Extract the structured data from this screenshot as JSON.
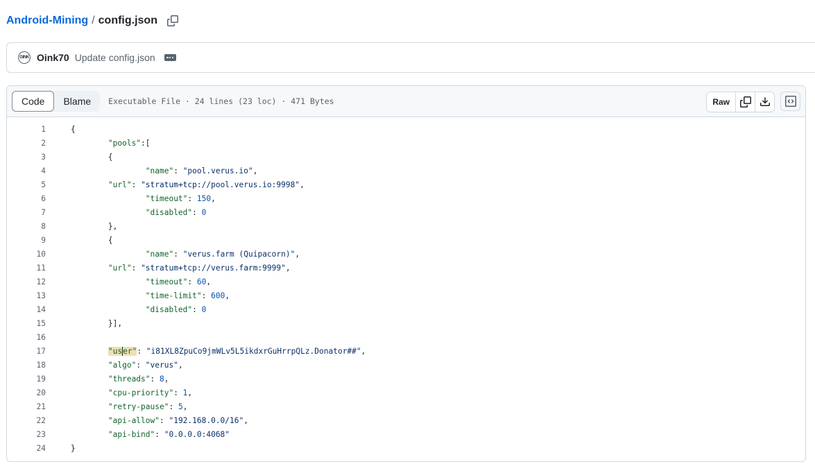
{
  "breadcrumb": {
    "repo": "Android-Mining",
    "separator": "/",
    "file": "config.json"
  },
  "commit": {
    "avatar_text": "OINK",
    "author": "Oink70",
    "message": "Update config.json"
  },
  "file_header": {
    "tabs": [
      {
        "label": "Code",
        "active": true
      },
      {
        "label": "Blame",
        "active": false
      }
    ],
    "meta": "Executable File · 24 lines (23 loc) · 471 Bytes",
    "raw_label": "Raw"
  },
  "code_lines": [
    {
      "num": "1",
      "text": "{"
    },
    {
      "num": "2",
      "text": "        \"pools\":["
    },
    {
      "num": "3",
      "text": "        {"
    },
    {
      "num": "4",
      "text": "                \"name\": \"pool.verus.io\","
    },
    {
      "num": "5",
      "text": "        \"url\": \"stratum+tcp://pool.verus.io:9998\","
    },
    {
      "num": "6",
      "text": "                \"timeout\": 150,"
    },
    {
      "num": "7",
      "text": "                \"disabled\": 0"
    },
    {
      "num": "8",
      "text": "        },"
    },
    {
      "num": "9",
      "text": "        {"
    },
    {
      "num": "10",
      "text": "                \"name\": \"verus.farm (Quipacorn)\","
    },
    {
      "num": "11",
      "text": "        \"url\": \"stratum+tcp://verus.farm:9999\","
    },
    {
      "num": "12",
      "text": "                \"timeout\": 60,"
    },
    {
      "num": "13",
      "text": "                \"time-limit\": 600,"
    },
    {
      "num": "14",
      "text": "                \"disabled\": 0"
    },
    {
      "num": "15",
      "text": "        }],"
    },
    {
      "num": "16",
      "text": ""
    },
    {
      "num": "17",
      "text": "        \"user\": \"i81XL8ZpuCo9jmWLv5L5ikdxrGuHrrpQLz.Donator##\","
    },
    {
      "num": "18",
      "text": "        \"algo\": \"verus\","
    },
    {
      "num": "19",
      "text": "        \"threads\": 8,"
    },
    {
      "num": "20",
      "text": "        \"cpu-priority\": 1,"
    },
    {
      "num": "21",
      "text": "        \"retry-pause\": 5,"
    },
    {
      "num": "22",
      "text": "        \"api-allow\": \"192.168.0.0/16\","
    },
    {
      "num": "23",
      "text": "        \"api-bind\": \"0.0.0.0:4068\""
    },
    {
      "num": "24",
      "text": "}"
    }
  ],
  "highlight": {
    "line": 17,
    "word": "user"
  },
  "colors": {
    "link": "#0969da",
    "key": "#116329",
    "string": "#0a3069",
    "number": "#0550ae",
    "highlight": "#eedfb3"
  },
  "icons": [
    "copy-icon",
    "ellipsis-icon",
    "download-icon",
    "code-square-icon"
  ]
}
